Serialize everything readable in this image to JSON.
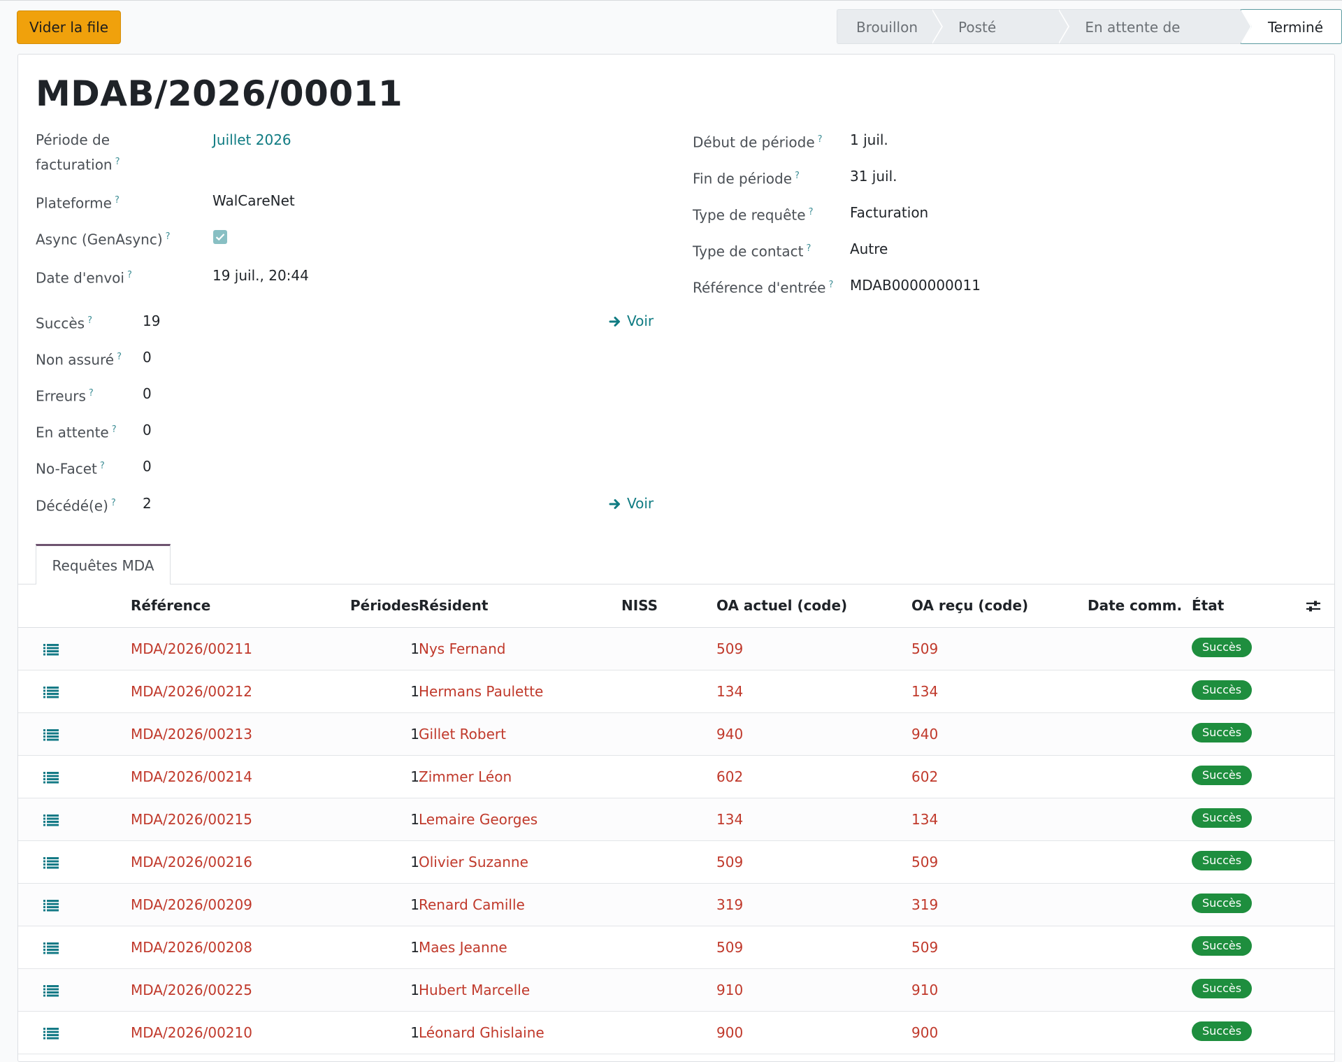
{
  "actions": {
    "flush_label": "Vider la file"
  },
  "statusbar": {
    "stages": [
      "Brouillon",
      "Posté (Async)",
      "En attente de réponse"
    ],
    "active": "Terminé"
  },
  "record": {
    "title": "MDAB/2026/00011",
    "left": {
      "periode_label_1": "Période de",
      "periode_label_2": "facturation",
      "periode_value": "Juillet 2026",
      "plateforme_label": "Plateforme",
      "plateforme_value": "WalCareNet",
      "async_label": "Async (GenAsync)",
      "async_checked": true,
      "date_envoi_label": "Date d'envoi",
      "date_envoi_value": "19 juil., 20:44"
    },
    "right": {
      "debut_label": "Début de période",
      "debut_value": "1 juil.",
      "fin_label": "Fin de période",
      "fin_value": "31 juil.",
      "type_requete_label": "Type de requête",
      "type_requete_value": "Facturation",
      "type_contact_label": "Type de contact",
      "type_contact_value": "Autre",
      "ref_entree_label": "Référence d'entrée",
      "ref_entree_value": "MDAB0000000011"
    },
    "counts": [
      {
        "label": "Succès",
        "value": "19",
        "link": "Voir"
      },
      {
        "label": "Non assuré",
        "value": "0"
      },
      {
        "label": "Erreurs",
        "value": "0"
      },
      {
        "label": "En attente",
        "value": "0"
      },
      {
        "label": "No-Facet",
        "value": "0"
      },
      {
        "label": "Décédé(e)",
        "value": "2",
        "link": "Voir"
      }
    ],
    "help_mark": "?"
  },
  "tabs": {
    "requetes": "Requêtes MDA"
  },
  "table": {
    "headers": {
      "reference": "Référence",
      "periodes": "Périodes",
      "resident": "Résident",
      "niss": "NISS",
      "oa_actuel": "OA actuel (code)",
      "oa_recu": "OA reçu (code)",
      "date_comm": "Date comm.",
      "etat": "État"
    },
    "rows": [
      {
        "reference": "MDA/2026/00211",
        "periodes": "1",
        "resident": "Nys Fernand",
        "oa_actuel": "509",
        "oa_recu": "509",
        "etat": "Succès"
      },
      {
        "reference": "MDA/2026/00212",
        "periodes": "1",
        "resident": "Hermans Paulette",
        "oa_actuel": "134",
        "oa_recu": "134",
        "etat": "Succès"
      },
      {
        "reference": "MDA/2026/00213",
        "periodes": "1",
        "resident": "Gillet Robert",
        "oa_actuel": "940",
        "oa_recu": "940",
        "etat": "Succès"
      },
      {
        "reference": "MDA/2026/00214",
        "periodes": "1",
        "resident": "Zimmer Léon",
        "oa_actuel": "602",
        "oa_recu": "602",
        "etat": "Succès"
      },
      {
        "reference": "MDA/2026/00215",
        "periodes": "1",
        "resident": "Lemaire Georges",
        "oa_actuel": "134",
        "oa_recu": "134",
        "etat": "Succès"
      },
      {
        "reference": "MDA/2026/00216",
        "periodes": "1",
        "resident": "Olivier Suzanne",
        "oa_actuel": "509",
        "oa_recu": "509",
        "etat": "Succès"
      },
      {
        "reference": "MDA/2026/00209",
        "periodes": "1",
        "resident": "Renard Camille",
        "oa_actuel": "319",
        "oa_recu": "319",
        "etat": "Succès"
      },
      {
        "reference": "MDA/2026/00208",
        "periodes": "1",
        "resident": "Maes Jeanne",
        "oa_actuel": "509",
        "oa_recu": "509",
        "etat": "Succès"
      },
      {
        "reference": "MDA/2026/00225",
        "periodes": "1",
        "resident": "Hubert Marcelle",
        "oa_actuel": "910",
        "oa_recu": "910",
        "etat": "Succès"
      },
      {
        "reference": "MDA/2026/00210",
        "periodes": "1",
        "resident": "Léonard Ghislaine",
        "oa_actuel": "900",
        "oa_recu": "900",
        "etat": "Succès"
      }
    ]
  }
}
